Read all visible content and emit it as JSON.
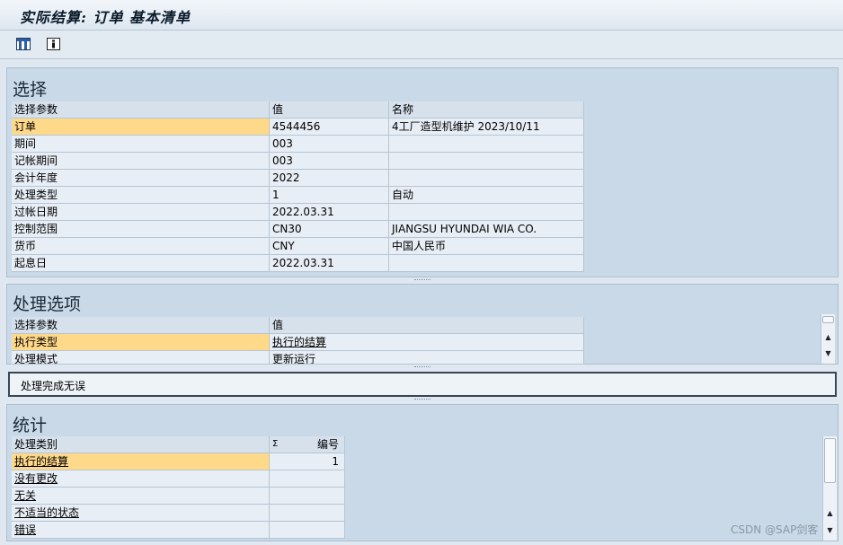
{
  "window": {
    "title": "实际结算: 订单 基本清单"
  },
  "toolbar": {
    "buttons": [
      {
        "icon": "layout-grid-icon"
      },
      {
        "icon": "info-icon"
      }
    ]
  },
  "selection": {
    "heading": "选择",
    "columns": [
      "选择参数",
      "值",
      "名称"
    ],
    "rows": [
      {
        "param": "订单",
        "value": "4544456",
        "name": "4工厂造型机维护 2023/10/11"
      },
      {
        "param": "期间",
        "value": "003",
        "name": ""
      },
      {
        "param": "记帐期间",
        "value": "003",
        "name": ""
      },
      {
        "param": "会计年度",
        "value": "2022",
        "name": ""
      },
      {
        "param": "处理类型",
        "value": "1",
        "name": "自动"
      },
      {
        "param": "过帐日期",
        "value": "2022.03.31",
        "name": ""
      },
      {
        "param": "控制范围",
        "value": "CN30",
        "name": "JIANGSU HYUNDAI WIA CO."
      },
      {
        "param": "货币",
        "value": "CNY",
        "name": "中国人民币"
      },
      {
        "param": "起息日",
        "value": "2022.03.31",
        "name": ""
      }
    ]
  },
  "processing": {
    "heading": "处理选项",
    "columns": [
      "选择参数",
      "值"
    ],
    "rows": [
      {
        "param": "执行类型",
        "value": "执行的结算"
      },
      {
        "param": "处理模式",
        "value": "更新运行"
      }
    ]
  },
  "status": {
    "message": "处理完成无误"
  },
  "statistics": {
    "heading": "统计",
    "columns": [
      "处理类别",
      "编号"
    ],
    "sum_symbol": "Σ",
    "rows": [
      {
        "category": "执行的结算",
        "count": "1"
      },
      {
        "category": "没有更改",
        "count": ""
      },
      {
        "category": "无关",
        "count": ""
      },
      {
        "category": "不适当的状态",
        "count": ""
      },
      {
        "category": "错误",
        "count": ""
      }
    ]
  },
  "watermark": "CSDN @SAP剑客"
}
